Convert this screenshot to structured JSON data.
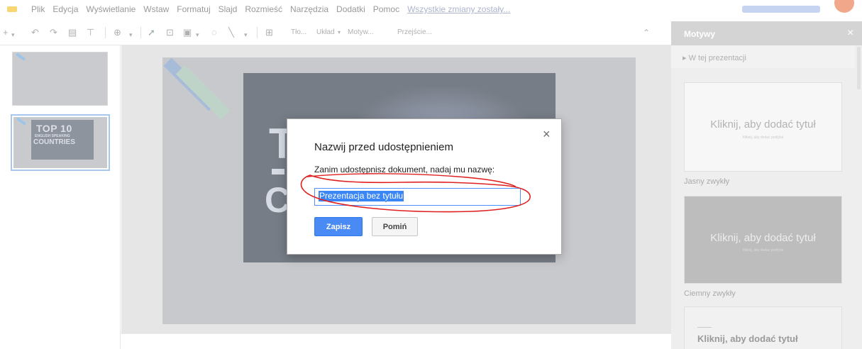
{
  "menu": {
    "items": [
      "Plik",
      "Edycja",
      "Wyświetlanie",
      "Wstaw",
      "Formatuj",
      "Slajd",
      "Rozmieść",
      "Narzędzia",
      "Dodatki",
      "Pomoc"
    ],
    "saved_status": "Wszystkie zmiany zostały..."
  },
  "toolbar": {
    "background_label": "Tło...",
    "layout_label": "Układ",
    "theme_label": "Motyw...",
    "transition_label": "Przejście..."
  },
  "slides": {
    "thumb2_line1": "TOP 10",
    "thumb2_line2": "ENGLISH SPEAKING",
    "thumb2_line3": "COUNTRIES"
  },
  "canvas": {
    "big_text": "T",
    "big_text2": "C"
  },
  "themes_panel": {
    "title": "Motywy",
    "close_glyph": "×",
    "section": "W tej prezentacji",
    "light_title": "Kliknij, aby dodać tytuł",
    "light_subtitle": "Kliknij, aby dodać podtytuł",
    "light_name": "Jasny zwykły",
    "dark_title": "Kliknij, aby dodać tytuł",
    "dark_subtitle": "Kliknij, aby dodać podtytuł",
    "dark_name": "Ciemny zwykły",
    "third_title": "Kliknij, aby dodać tytuł"
  },
  "dialog": {
    "title": "Nazwij przed udostępnieniem",
    "prompt": "Zanim udostępnisz dokument, nadaj mu nazwę:",
    "name_value": "Prezentacja bez tytułu",
    "save_label": "Zapisz",
    "skip_label": "Pomiń",
    "close_glyph": "×"
  },
  "colors": {
    "accent_blue": "#4a8af4",
    "annotation_red": "#e02020"
  }
}
